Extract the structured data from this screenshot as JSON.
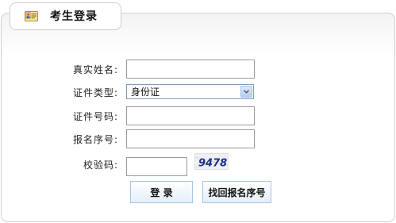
{
  "header": {
    "title": "考生登录",
    "icon": "id-card-icon"
  },
  "form": {
    "real_name_label": "真实姓名:",
    "real_name_value": "",
    "id_type_label": "证件类型:",
    "id_type_value": "身份证",
    "id_number_label": "证件号码:",
    "id_number_value": "",
    "reg_number_label": "报名序号:",
    "reg_number_value": "",
    "captcha_label": "校验码:",
    "captcha_value": "",
    "captcha_image_text": "9478"
  },
  "buttons": {
    "login_label": "登 录",
    "recover_label": "找回报名序号"
  },
  "colors": {
    "border": "#cfcfcf",
    "button_border": "#a9c4e2",
    "captcha_text": "#1f2f86"
  }
}
